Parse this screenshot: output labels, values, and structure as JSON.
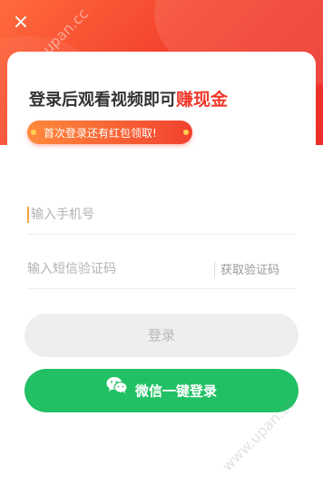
{
  "close": {
    "icon": "close-icon",
    "glyph": "×"
  },
  "headline": {
    "prefix": "登录后观看视频即可",
    "accent": "赚现金"
  },
  "banner": {
    "text": "首次登录还有红包领取!"
  },
  "phone": {
    "placeholder": "输入手机号",
    "value": ""
  },
  "sms": {
    "placeholder": "输入短信验证码",
    "value": "",
    "get_code_label": "获取验证码"
  },
  "login_button": {
    "label": "登录"
  },
  "wechat_button": {
    "label": "微信一键登录",
    "icon": "wechat-icon"
  },
  "watermark": "www.upan.cc",
  "colors": {
    "accent": "#f0382b",
    "wechat_green": "#21c064",
    "disabled_bg": "#eeeeee"
  }
}
